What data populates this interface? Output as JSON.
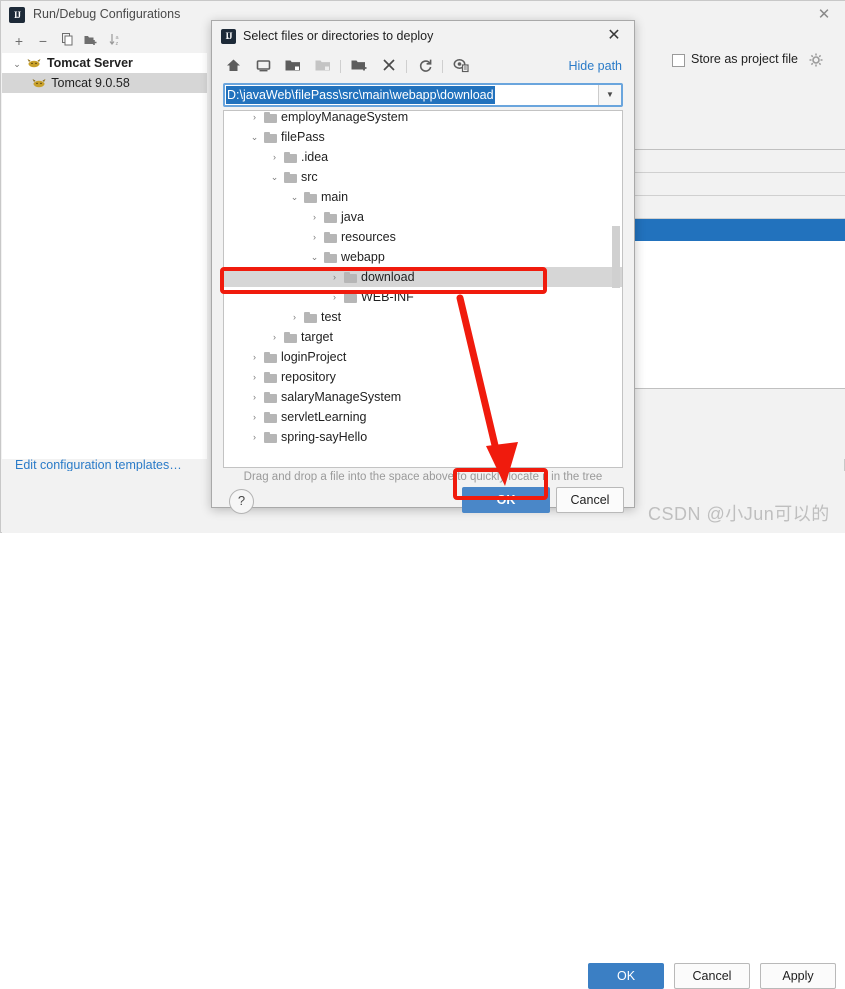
{
  "background_dialog": {
    "title": "Run/Debug Configurations",
    "app_icon": "intellij-idea-icon",
    "close_icon": "close-icon",
    "toolbar": [
      {
        "name": "add-configuration-button",
        "glyph": "+"
      },
      {
        "name": "remove-configuration-button",
        "glyph": "−"
      },
      {
        "name": "copy-configuration-button",
        "glyph": "❐"
      },
      {
        "name": "add-folder-button",
        "glyph": "⧉"
      },
      {
        "name": "sort-configurations-button",
        "glyph": "↓"
      }
    ],
    "tree": [
      {
        "label": "Tomcat Server",
        "chevron": "⌄",
        "selected": false,
        "level": 0,
        "icon": "tomcat-icon"
      },
      {
        "label": "Tomcat 9.0.58",
        "chevron": "",
        "selected": true,
        "level": 1,
        "icon": "tomcat-icon"
      }
    ],
    "edit_templates_link": "Edit configuration templates…",
    "help_label": "?",
    "store_as_project_file": "Store as project file",
    "gear_icon": "gear-icon",
    "buttons": {
      "ok": "OK",
      "cancel": "Cancel",
      "apply": "Apply"
    }
  },
  "file_chooser": {
    "title": "Select files or directories to deploy",
    "app_icon": "intellij-idea-icon",
    "close_icon": "close-icon",
    "toolbar": [
      {
        "name": "home-icon",
        "title": "Home"
      },
      {
        "name": "desktop-icon",
        "title": "Desktop"
      },
      {
        "name": "project-folder-icon",
        "title": "Project Directory"
      },
      {
        "name": "module-folder-icon",
        "title": "Module Directory",
        "disabled": true
      },
      {
        "name": "new-folder-icon",
        "title": "New Folder"
      },
      {
        "name": "delete-icon",
        "title": "Delete"
      },
      {
        "name": "refresh-icon",
        "title": "Refresh"
      },
      {
        "name": "show-hidden-icon",
        "title": "Show Hidden Files"
      }
    ],
    "hide_path_link": "Hide path",
    "path_value": "D:\\javaWeb\\filePass\\src\\main\\webapp\\download",
    "path_dropdown_icon": "chevron-down-icon",
    "tree": [
      {
        "label": "employManageSystem",
        "level": 1,
        "chevron": "›",
        "selected": false
      },
      {
        "label": "filePass",
        "level": 1,
        "chevron": "⌄",
        "selected": false
      },
      {
        "label": ".idea",
        "level": 2,
        "chevron": "›",
        "selected": false
      },
      {
        "label": "src",
        "level": 2,
        "chevron": "⌄",
        "selected": false
      },
      {
        "label": "main",
        "level": 3,
        "chevron": "⌄",
        "selected": false
      },
      {
        "label": "java",
        "level": 4,
        "chevron": "›",
        "selected": false
      },
      {
        "label": "resources",
        "level": 4,
        "chevron": "›",
        "selected": false
      },
      {
        "label": "webapp",
        "level": 4,
        "chevron": "⌄",
        "selected": false
      },
      {
        "label": "download",
        "level": 5,
        "chevron": "›",
        "selected": true
      },
      {
        "label": "WEB-INF",
        "level": 5,
        "chevron": "›",
        "selected": false
      },
      {
        "label": "test",
        "level": 3,
        "chevron": "›",
        "selected": false
      },
      {
        "label": "target",
        "level": 2,
        "chevron": "›",
        "selected": false
      },
      {
        "label": "loginProject",
        "level": 1,
        "chevron": "›",
        "selected": false
      },
      {
        "label": "repository",
        "level": 1,
        "chevron": "›",
        "selected": false
      },
      {
        "label": "salaryManageSystem",
        "level": 1,
        "chevron": "›",
        "selected": false
      },
      {
        "label": "servletLearning",
        "level": 1,
        "chevron": "›",
        "selected": false
      },
      {
        "label": "spring-sayHello",
        "level": 1,
        "chevron": "›",
        "selected": false
      }
    ],
    "hint": "Drag and drop a file into the space above to quickly locate it in the tree",
    "help_label": "?",
    "buttons": {
      "ok": "OK",
      "cancel": "Cancel"
    }
  },
  "annotations": {
    "highlight_download_row": "red-box-around-download-row",
    "highlight_ok_button": "red-box-around-ok-button",
    "arrow": "red-arrow-pointing-to-ok-button"
  },
  "watermark": {
    "text": "CSDN @小Jun可以的"
  },
  "colors": {
    "accent_blue": "#2272bd",
    "link_blue": "#2a7bc8",
    "annotation_red": "#f01b0d",
    "ok_button_blue": "#4a87c8",
    "selection_gray": "#d6d6d6",
    "window_gray": "#f2f2f2"
  }
}
